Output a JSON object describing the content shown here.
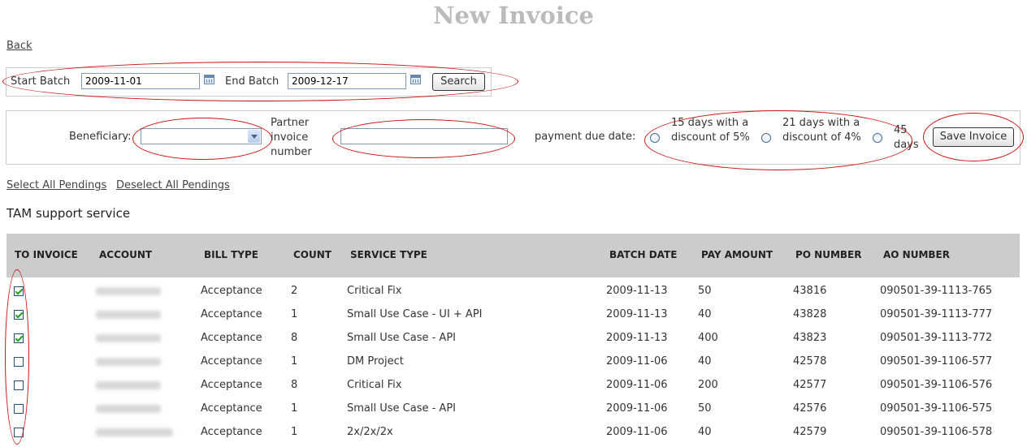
{
  "page": {
    "title": "New Invoice",
    "back_label": "Back"
  },
  "batch": {
    "start_label": "Start Batch",
    "start_value": "2009-11-01",
    "end_label": "End Batch",
    "end_value": "2009-12-17",
    "search_label": "Search"
  },
  "invoice_form": {
    "beneficiary_label": "Beneficiary:",
    "beneficiary_value": "",
    "partner_label": "Partner\ninvoice\nnumber",
    "partner_value": "",
    "due_label": "payment due date:",
    "options": [
      {
        "label": "15 days with a discount of 5%",
        "selected": false
      },
      {
        "label": "21 days with a discount of 4%",
        "selected": false
      },
      {
        "label": "45 days",
        "selected": false
      }
    ],
    "save_label": "Save Invoice"
  },
  "selection": {
    "select_all": "Select All Pendings",
    "deselect_all": "Deselect All Pendings"
  },
  "section_title": "TAM support service",
  "table": {
    "columns": [
      "TO INVOICE",
      "ACCOUNT",
      "BILL TYPE",
      "COUNT",
      "SERVICE TYPE",
      "BATCH DATE",
      "PAY AMOUNT",
      "PO NUMBER",
      "AO NUMBER"
    ],
    "rows": [
      {
        "checked": true,
        "bill_type": "Acceptance",
        "count": "2",
        "service_type": "Critical Fix",
        "batch_date": "2009-11-13",
        "pay_amount": "50",
        "po_number": "43816",
        "ao_number": "090501-39-1113-765"
      },
      {
        "checked": true,
        "bill_type": "Acceptance",
        "count": "1",
        "service_type": "Small Use Case - UI + API",
        "batch_date": "2009-11-13",
        "pay_amount": "40",
        "po_number": "43828",
        "ao_number": "090501-39-1113-777"
      },
      {
        "checked": true,
        "bill_type": "Acceptance",
        "count": "8",
        "service_type": "Small Use Case - API",
        "batch_date": "2009-11-13",
        "pay_amount": "400",
        "po_number": "43823",
        "ao_number": "090501-39-1113-772"
      },
      {
        "checked": false,
        "bill_type": "Acceptance",
        "count": "1",
        "service_type": "DM Project",
        "batch_date": "2009-11-06",
        "pay_amount": "40",
        "po_number": "42578",
        "ao_number": "090501-39-1106-577"
      },
      {
        "checked": false,
        "bill_type": "Acceptance",
        "count": "8",
        "service_type": "Critical Fix",
        "batch_date": "2009-11-06",
        "pay_amount": "200",
        "po_number": "42577",
        "ao_number": "090501-39-1106-576"
      },
      {
        "checked": false,
        "bill_type": "Acceptance",
        "count": "1",
        "service_type": "Small Use Case - API",
        "batch_date": "2009-11-06",
        "pay_amount": "50",
        "po_number": "42576",
        "ao_number": "090501-39-1106-575"
      },
      {
        "checked": false,
        "bill_type": "Acceptance",
        "count": "1",
        "service_type": "2x/2x/2x",
        "batch_date": "2009-11-06",
        "pay_amount": "40",
        "po_number": "42579",
        "ao_number": "090501-39-1106-578"
      }
    ]
  },
  "colors": {
    "annotation": "#cc1111",
    "header_bg": "#cccccc",
    "check": "#21a121"
  }
}
